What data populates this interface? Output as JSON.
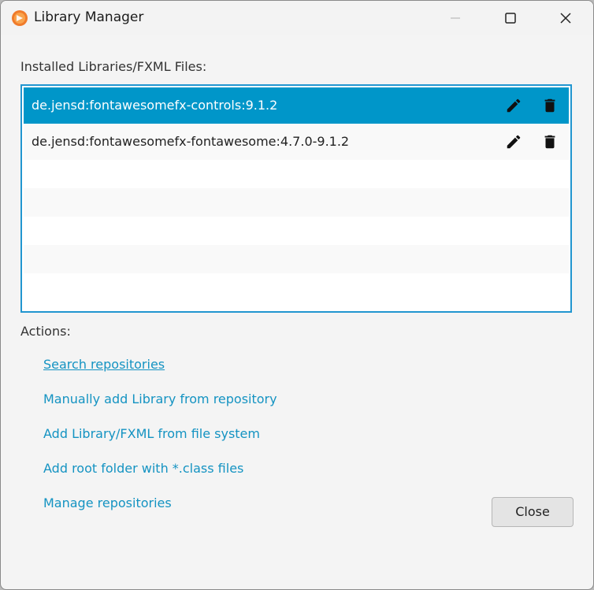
{
  "window": {
    "title": "Library Manager",
    "controls": [
      "minimize",
      "maximize",
      "close"
    ]
  },
  "installed": {
    "label": "Installed Libraries/FXML Files:",
    "items": [
      {
        "name": "de.jensd:fontawesomefx-controls:9.1.2",
        "selected": true
      },
      {
        "name": "de.jensd:fontawesomefx-fontawesome:4.7.0-9.1.2",
        "selected": false
      }
    ],
    "row_icons": [
      "pencil-icon",
      "trash-icon"
    ]
  },
  "actions": {
    "label": "Actions:",
    "links": [
      "Search repositories",
      "Manually add Library from repository",
      "Add Library/FXML from file system",
      "Add root folder with *.class files",
      "Manage repositories"
    ]
  },
  "footer": {
    "close_label": "Close"
  },
  "colors": {
    "selection": "#0096c9",
    "link": "#1493c2",
    "list_border": "#2196d0",
    "app_icon": "#f07b2a"
  }
}
